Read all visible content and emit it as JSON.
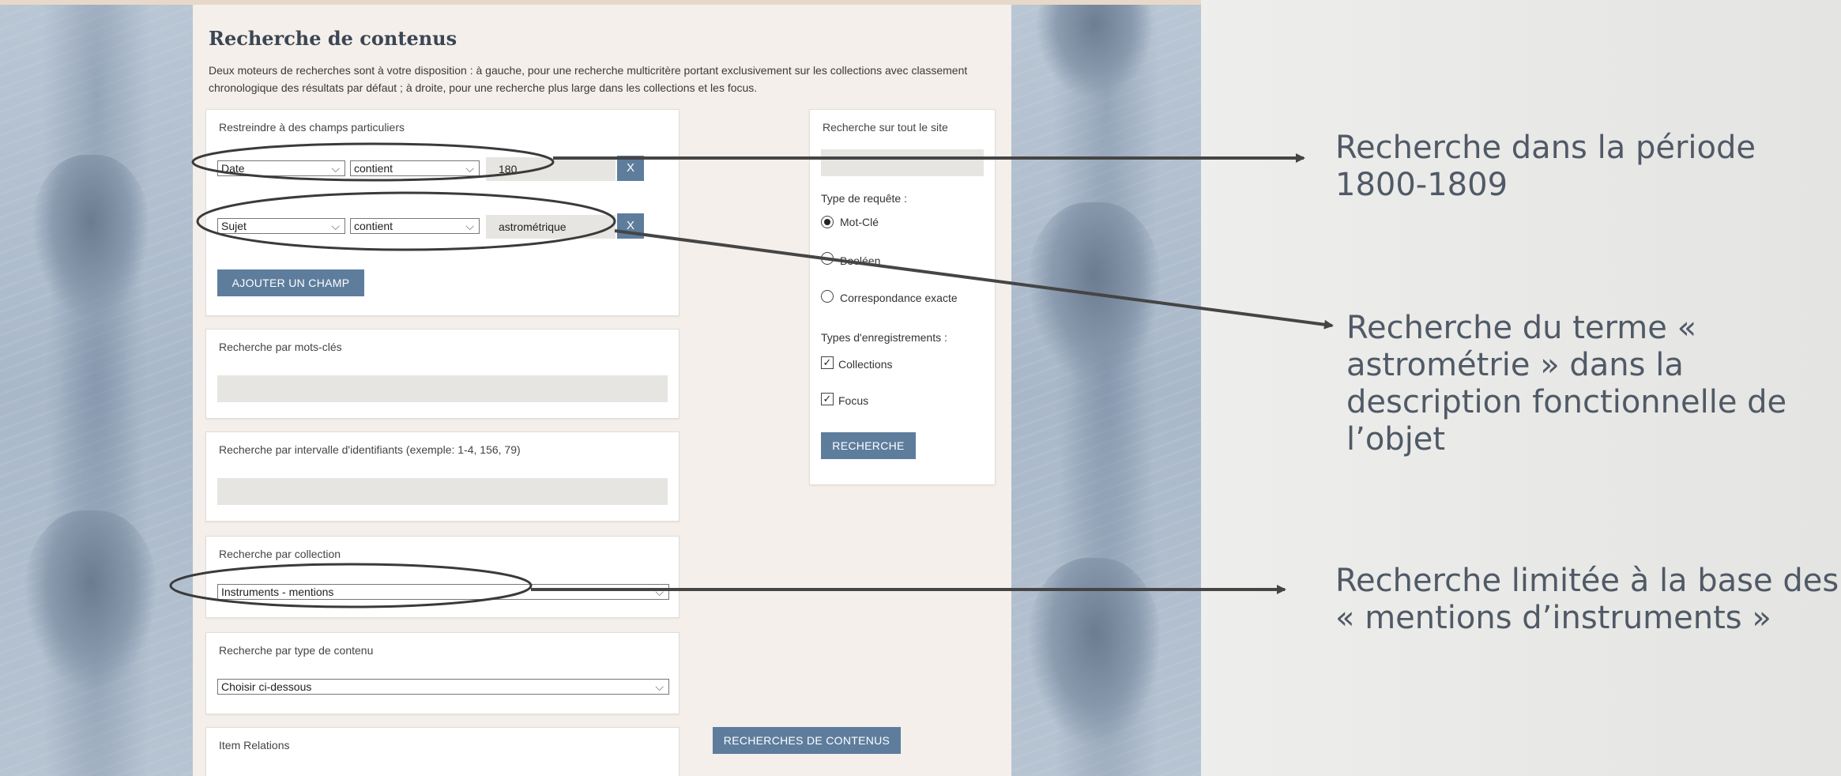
{
  "page": {
    "title": "Recherche de contenus",
    "intro": "Deux moteurs de recherches sont à votre disposition : à gauche, pour une recherche multicritère portant exclusivement sur les collections avec classement chronologique des résultats par défaut ; à droite, pour une recherche plus large dans les collections et les focus."
  },
  "restrict": {
    "label": "Restreindre à des champs particuliers",
    "rows": [
      {
        "field": "Date",
        "operator": "contient",
        "value": "180",
        "remove": "X"
      },
      {
        "field": "Sujet",
        "operator": "contient",
        "value": "astrométrique",
        "remove": "X"
      }
    ],
    "add_field": "AJOUTER UN CHAMP"
  },
  "keywords": {
    "label": "Recherche par mots-clés",
    "value": ""
  },
  "id_range": {
    "label": "Recherche par intervalle d'identifiants (exemple: 1-4, 156, 79)",
    "value": ""
  },
  "collection": {
    "label": "Recherche par collection",
    "selected": "Instruments - mentions"
  },
  "content_type": {
    "label": "Recherche par type de contenu",
    "selected": "Choisir ci-dessous"
  },
  "item_relations": {
    "label": "Item Relations"
  },
  "submit_label": "RECHERCHES DE CONTENUS",
  "site_search": {
    "label": "Recherche sur tout le site",
    "value": "",
    "query_type_label": "Type de requête :",
    "query_types": [
      {
        "label": "Mot-Clé",
        "checked": true
      },
      {
        "label": "Booléen",
        "checked": false
      },
      {
        "label": "Correspondance exacte",
        "checked": false
      }
    ],
    "record_types_label": "Types d'enregistrements :",
    "record_types": [
      {
        "label": "Collections",
        "checked": true
      },
      {
        "label": "Focus",
        "checked": true
      }
    ],
    "button": "RECHERCHE"
  },
  "annotations": {
    "period": "Recherche dans la période 1800-1809",
    "term": "Recherche du terme « astrométrie » dans la description fonctionnelle de l’objet",
    "base": "Recherche limitée à la base des « mentions d’instruments »"
  },
  "colors": {
    "accent": "#5e7d9d",
    "annotation": "#505a66",
    "frame": "#f4efea"
  }
}
